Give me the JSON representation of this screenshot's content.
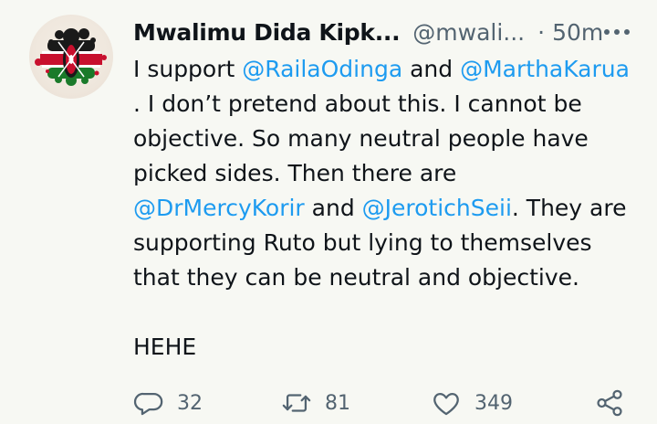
{
  "author": {
    "name": "Mwalimu Dida Kipk...",
    "handle": "@mwali...",
    "separator": "·",
    "time": "50m"
  },
  "tweet": {
    "line1": {
      "pre": "I support ",
      "m1": "@RailaOdinga",
      "mid": " and ",
      "m2": "@MarthaKarua"
    },
    "line2": ". I don’t pretend about this. I cannot be",
    "line3": "objective. So many neutral people have",
    "line4": "picked sides. Then there are",
    "line5": {
      "m1": "@DrMercyKorir",
      "mid": " and ",
      "m2": "@JerotichSeii",
      "post": ". They are"
    },
    "line6": "supporting Ruto but lying to themselves",
    "line7": "that they can be neutral and objective.",
    "line8": "HEHE"
  },
  "actions": {
    "reply_count": "32",
    "retweet_count": "81",
    "like_count": "349"
  },
  "icons": [
    "more-icon",
    "reply-icon",
    "retweet-icon",
    "like-icon",
    "share-icon",
    "kenya-flag-avatar"
  ],
  "colors": {
    "background": "#f7f8f3",
    "mention": "#1d9bf0",
    "secondary_text": "#536471",
    "primary_text": "#0f1419"
  }
}
